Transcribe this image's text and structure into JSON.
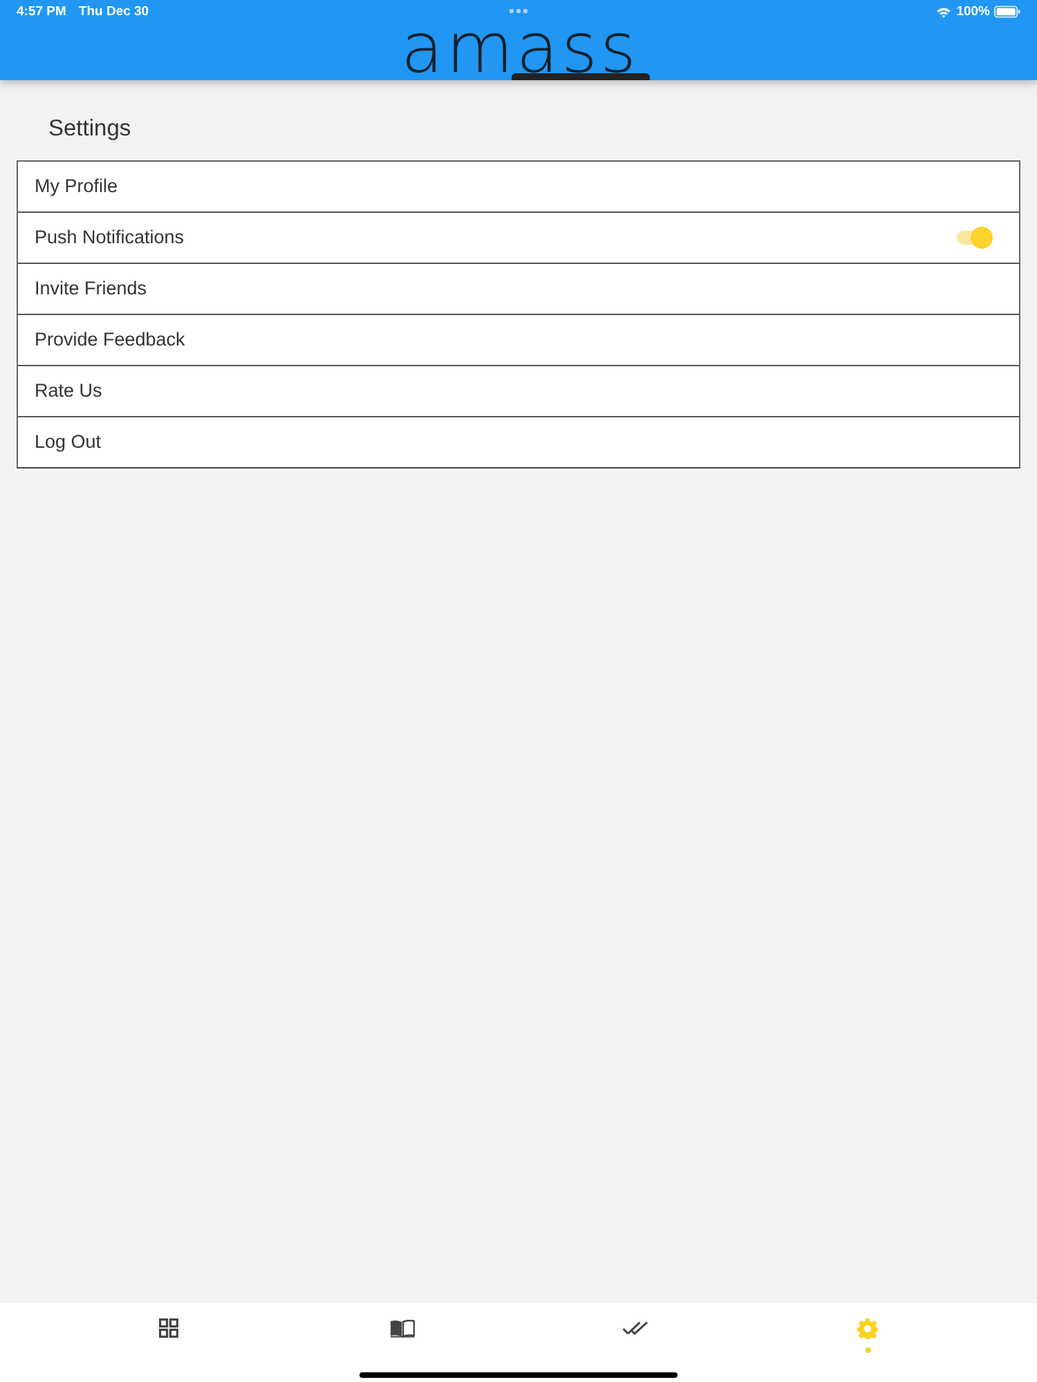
{
  "status_bar": {
    "time": "4:57 PM",
    "date": "Thu Dec 30",
    "battery": "100%"
  },
  "header": {
    "logo": "amass"
  },
  "page_title": "Settings",
  "settings": [
    {
      "kind": "link",
      "label": "My Profile"
    },
    {
      "kind": "toggle",
      "label": "Push Notifications",
      "on": true
    },
    {
      "kind": "link",
      "label": "Invite Friends"
    },
    {
      "kind": "link",
      "label": "Provide Feedback"
    },
    {
      "kind": "link",
      "label": "Rate Us"
    },
    {
      "kind": "link",
      "label": "Log Out"
    }
  ],
  "tabs": [
    {
      "selected": false
    },
    {
      "selected": false
    },
    {
      "selected": false
    },
    {
      "selected": true
    }
  ]
}
